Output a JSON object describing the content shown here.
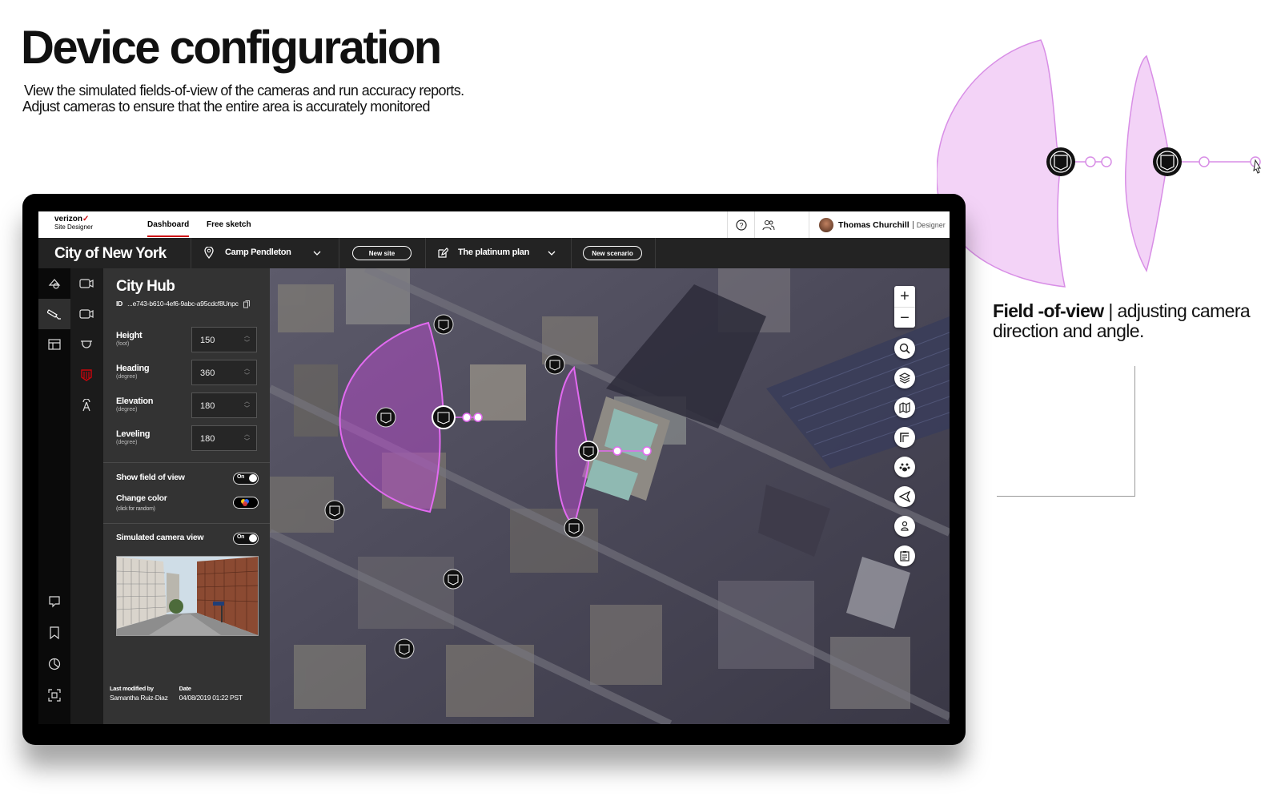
{
  "page": {
    "title": "Device configuration",
    "description_line1": "View the simulated fields-of-view of the cameras and run accuracy reports.",
    "description_line2": "Adjust cameras to ensure that the entire area is accurately monitored"
  },
  "fov_caption": {
    "bold": "Field -of-view",
    "separator": " | ",
    "text": "adjusting camera direction and angle."
  },
  "app": {
    "brand": "verizon",
    "brand_mark": "✓",
    "product": "Site Designer",
    "nav": [
      "Dashboard",
      "Free sketch"
    ],
    "active_nav": "Dashboard",
    "icons": {
      "help": "help-icon",
      "team": "users-icon"
    },
    "user": {
      "name": "Thomas Churchill",
      "role": "Designer"
    },
    "accent": "#cd040b"
  },
  "subbar": {
    "city": "City of New York",
    "site": "Camp Pendleton",
    "new_site": "New site",
    "plan": "The platinum plan",
    "new_scenario": "New scenario"
  },
  "panel": {
    "title": "City Hub",
    "id_label": "ID",
    "id_value": "...e743-b610-4ef6-9abc-a95cdcf8Unpc",
    "fields": [
      {
        "label": "Height",
        "unit": "(foot)",
        "value": "150"
      },
      {
        "label": "Heading",
        "unit": "(degree)",
        "value": "360"
      },
      {
        "label": "Elevation",
        "unit": "(degree)",
        "value": "180"
      },
      {
        "label": "Leveling",
        "unit": "(degree)",
        "value": "180"
      }
    ],
    "show_fov": {
      "label": "Show field of view",
      "state": "On"
    },
    "change_color": {
      "label": "Change color",
      "sub": "(click for random)"
    },
    "simulated": {
      "label": "Simulated camera view",
      "state": "On"
    },
    "footer": {
      "modified_label": "Last modified by",
      "modified_by": "Samantha Ruiz-Diaz",
      "date_label": "Date",
      "date_value": "04/08/2019  01:22 PST"
    }
  },
  "map": {
    "zoom_in": "+",
    "zoom_out": "−",
    "tools": [
      "search-icon",
      "layers-icon",
      "map-icon",
      "route-icon",
      "paw-icon",
      "navigate-icon",
      "user-pin-icon",
      "clipboard-icon"
    ],
    "fov_color": "#c04ad6"
  }
}
